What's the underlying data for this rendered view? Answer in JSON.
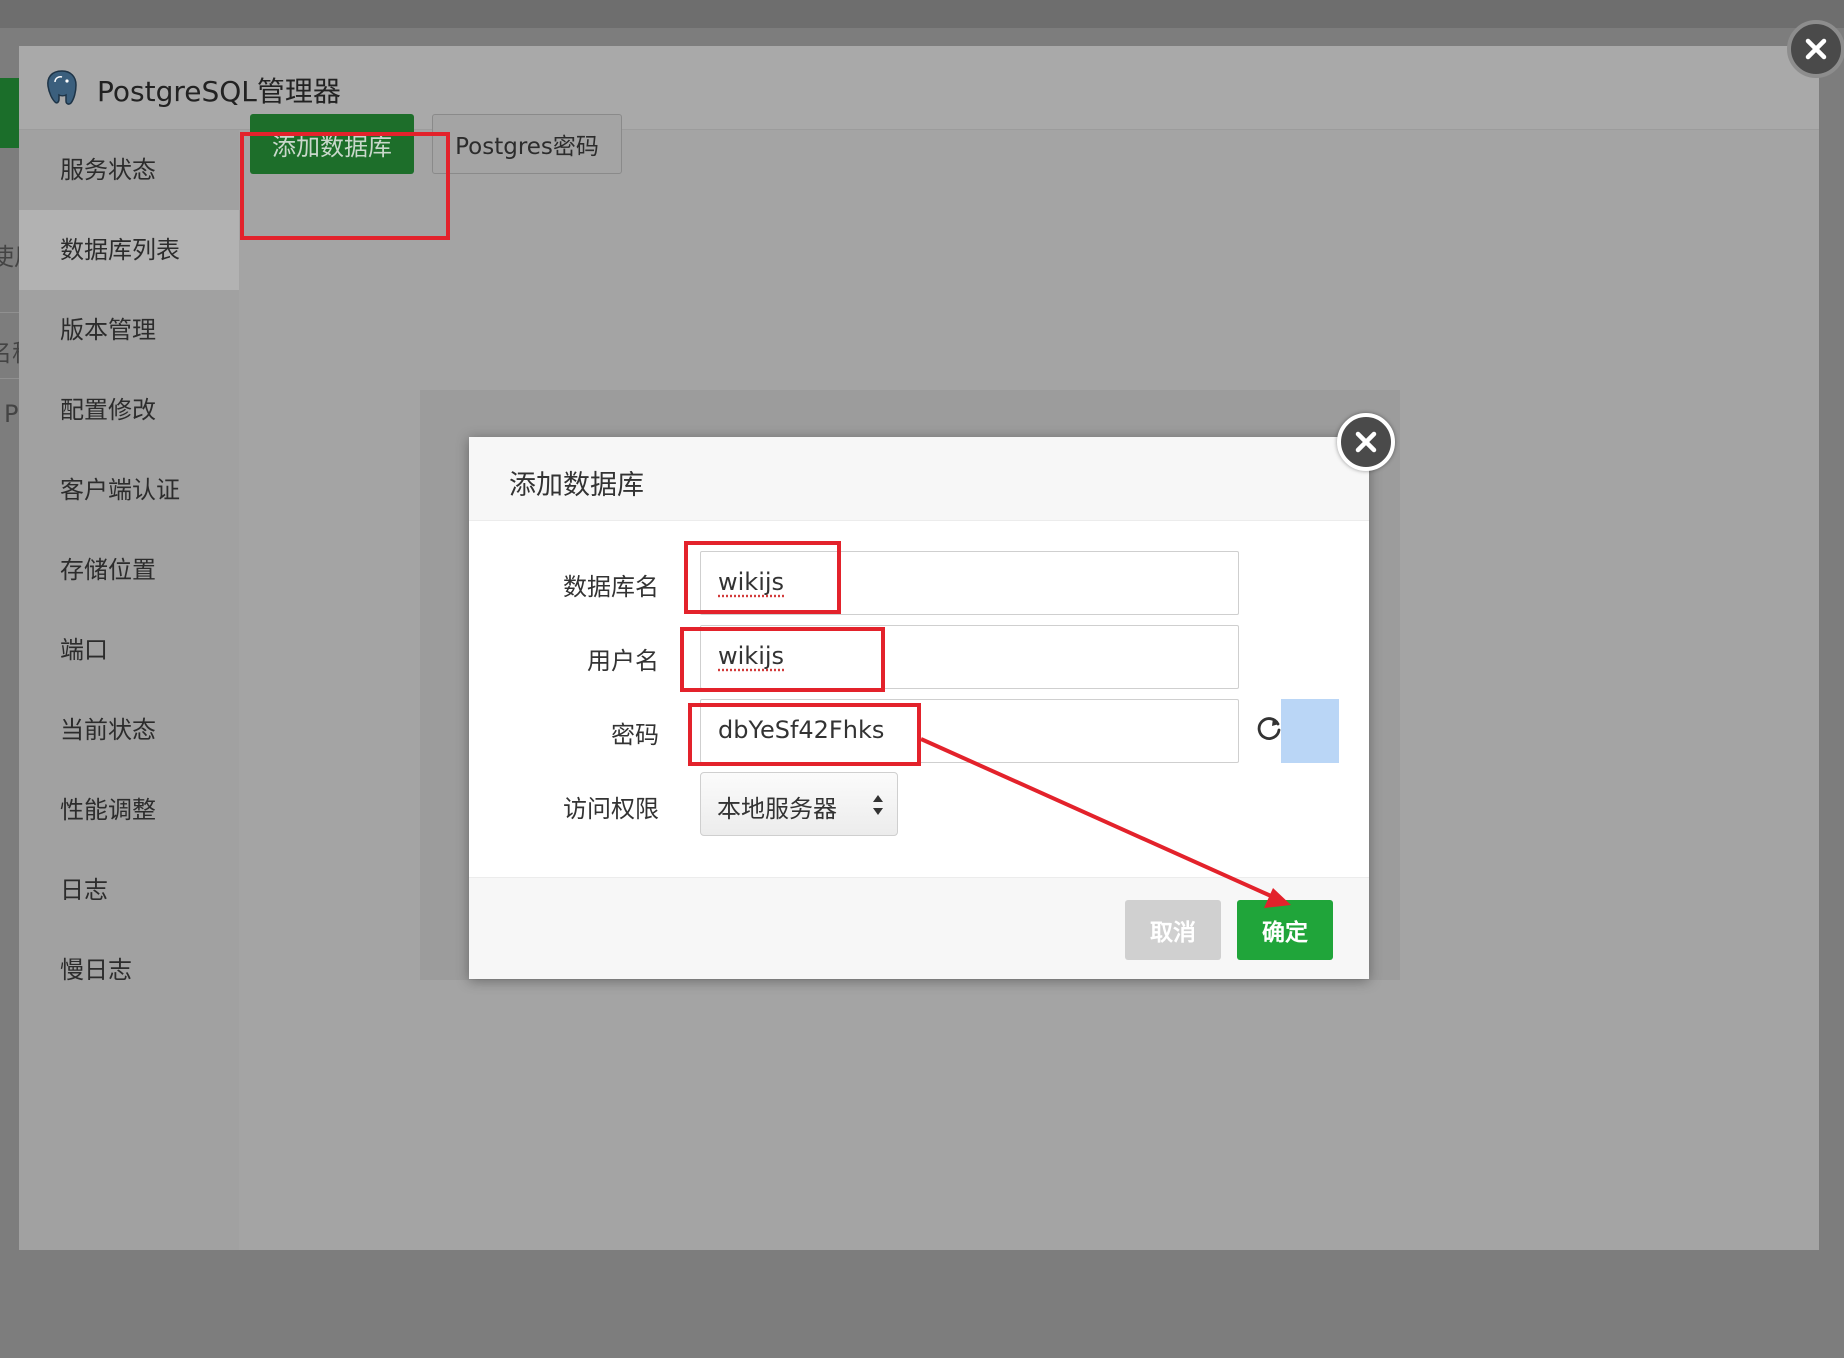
{
  "background": {
    "fragments": [
      "使用",
      "名称",
      "P"
    ]
  },
  "window": {
    "title": "PostgreSQL管理器",
    "logo_icon": "postgresql-elephant-icon",
    "close_icon": "close-icon"
  },
  "sidebar": {
    "items": [
      {
        "label": "服务状态",
        "active": false
      },
      {
        "label": "数据库列表",
        "active": true
      },
      {
        "label": "版本管理",
        "active": false
      },
      {
        "label": "配置修改",
        "active": false
      },
      {
        "label": "客户端认证",
        "active": false
      },
      {
        "label": "存储位置",
        "active": false
      },
      {
        "label": "端口",
        "active": false
      },
      {
        "label": "当前状态",
        "active": false
      },
      {
        "label": "性能调整",
        "active": false
      },
      {
        "label": "日志",
        "active": false
      },
      {
        "label": "慢日志",
        "active": false
      }
    ]
  },
  "toolbar": {
    "add_database_label": "添加数据库",
    "postgres_password_label": "Postgres密码"
  },
  "dialog": {
    "title": "添加数据库",
    "fields": {
      "db_name": {
        "label": "数据库名",
        "value": "wikijs"
      },
      "username": {
        "label": "用户名",
        "value": "wikijs"
      },
      "password": {
        "label": "密码",
        "value": "dbYeSf42Fhks"
      },
      "access": {
        "label": "访问权限",
        "value": "本地服务器"
      }
    },
    "cancel_label": "取消",
    "confirm_label": "确定"
  },
  "colors": {
    "primary_green": "#20a53a",
    "annotation_red": "#e3222b",
    "copy_highlight": "#bad6f6"
  }
}
